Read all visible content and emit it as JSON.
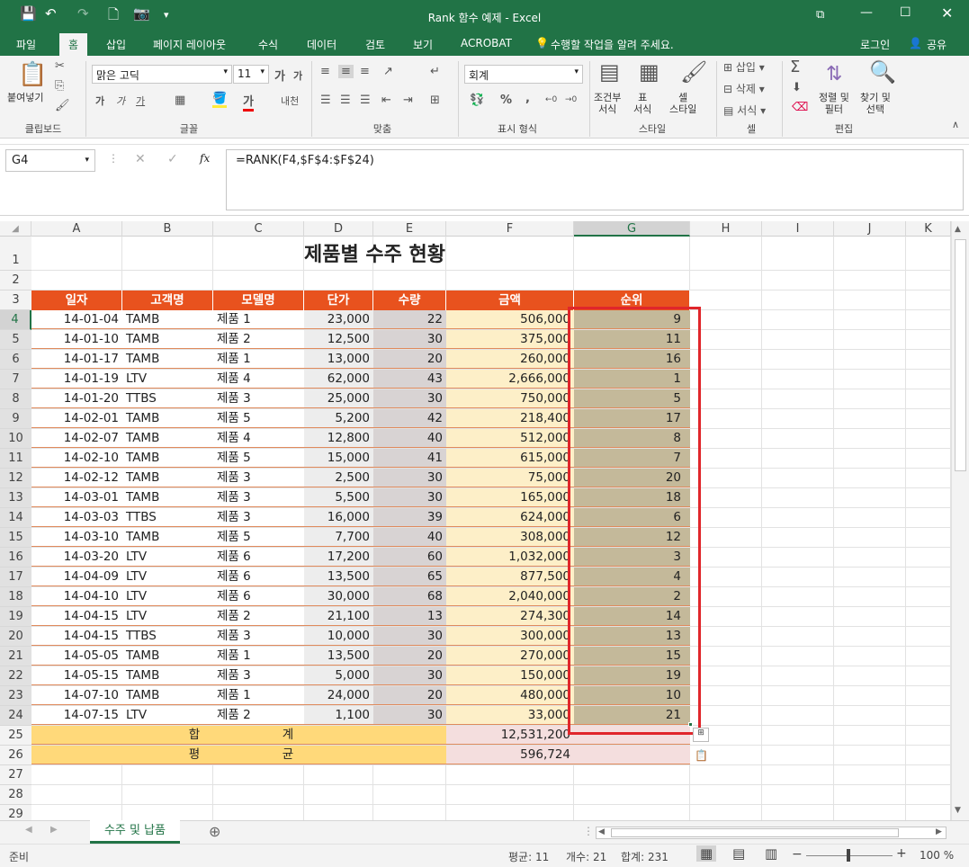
{
  "window": {
    "title": "Rank 함수 예제 - Excel",
    "qa_save": "💾",
    "qa_undo": "↶",
    "qa_redo": "↷",
    "qa_new": "🗋",
    "qa_camera": "📷",
    "qa_more": "▾"
  },
  "menu": {
    "tabs": [
      "파일",
      "홈",
      "삽입",
      "페이지 레이아웃",
      "수식",
      "데이터",
      "검토",
      "보기",
      "ACROBAT"
    ],
    "tell": "수행할 작업을 알려 주세요.",
    "login": "로그인",
    "share": "공유"
  },
  "ribbon": {
    "clipboard": {
      "paste": "붙여넣기",
      "group": "클립보드"
    },
    "font": {
      "name": "맑은 고딕",
      "size": "11",
      "bold": "가",
      "italic": "가",
      "underline": "가",
      "group": "글꼴",
      "grow": "가",
      "shrink": "가",
      "phonetic": "내천"
    },
    "align": {
      "group": "맞춤"
    },
    "number": {
      "format": "회계",
      "group": "표시 형식",
      "pct": "%",
      "comma": ","
    },
    "styles": {
      "cond": "조건부",
      "cond2": "서식",
      "table": "표",
      "table2": "서식",
      "cell": "셀",
      "cell2": "스타일",
      "group": "스타일"
    },
    "cells": {
      "insert": "삽입",
      "delete": "삭제",
      "format": "서식",
      "group": "셀"
    },
    "editing": {
      "sort": "정렬 및",
      "sort2": "필터",
      "find": "찾기 및",
      "find2": "선택",
      "group": "편집",
      "sigma": "Σ"
    }
  },
  "formula_bar": {
    "name_box": "G4",
    "fx": "fx",
    "formula": "=RANK(F4,$F$4:$F$24)"
  },
  "columns": [
    "A",
    "B",
    "C",
    "D",
    "E",
    "F",
    "G",
    "H",
    "I",
    "J",
    "K"
  ],
  "rows": [
    "1",
    "2",
    "3",
    "4",
    "5",
    "6",
    "7",
    "8",
    "9",
    "10",
    "11",
    "12",
    "13",
    "14",
    "15",
    "16",
    "17",
    "18",
    "19",
    "20",
    "21",
    "22",
    "23",
    "24",
    "25",
    "26",
    "27",
    "28",
    "29"
  ],
  "sheet": {
    "title": "제품별 수주 현황",
    "headers": [
      "일자",
      "고객명",
      "모델명",
      "단가",
      "수량",
      "금액",
      "순위"
    ],
    "data": [
      [
        "14-01-04",
        "TAMB",
        "제품 1",
        "23,000",
        "22",
        "506,000",
        "9"
      ],
      [
        "14-01-10",
        "TAMB",
        "제품 2",
        "12,500",
        "30",
        "375,000",
        "11"
      ],
      [
        "14-01-17",
        "TAMB",
        "제품 1",
        "13,000",
        "20",
        "260,000",
        "16"
      ],
      [
        "14-01-19",
        "LTV",
        "제품 4",
        "62,000",
        "43",
        "2,666,000",
        "1"
      ],
      [
        "14-01-20",
        "TTBS",
        "제품 3",
        "25,000",
        "30",
        "750,000",
        "5"
      ],
      [
        "14-02-01",
        "TAMB",
        "제품 5",
        "5,200",
        "42",
        "218,400",
        "17"
      ],
      [
        "14-02-07",
        "TAMB",
        "제품 4",
        "12,800",
        "40",
        "512,000",
        "8"
      ],
      [
        "14-02-10",
        "TAMB",
        "제품 5",
        "15,000",
        "41",
        "615,000",
        "7"
      ],
      [
        "14-02-12",
        "TAMB",
        "제품 3",
        "2,500",
        "30",
        "75,000",
        "20"
      ],
      [
        "14-03-01",
        "TAMB",
        "제품 3",
        "5,500",
        "30",
        "165,000",
        "18"
      ],
      [
        "14-03-03",
        "TTBS",
        "제품 3",
        "16,000",
        "39",
        "624,000",
        "6"
      ],
      [
        "14-03-10",
        "TAMB",
        "제품 5",
        "7,700",
        "40",
        "308,000",
        "12"
      ],
      [
        "14-03-20",
        "LTV",
        "제품 6",
        "17,200",
        "60",
        "1,032,000",
        "3"
      ],
      [
        "14-04-09",
        "LTV",
        "제품 6",
        "13,500",
        "65",
        "877,500",
        "4"
      ],
      [
        "14-04-10",
        "LTV",
        "제품 6",
        "30,000",
        "68",
        "2,040,000",
        "2"
      ],
      [
        "14-04-15",
        "LTV",
        "제품 2",
        "21,100",
        "13",
        "274,300",
        "14"
      ],
      [
        "14-04-15",
        "TTBS",
        "제품 3",
        "10,000",
        "30",
        "300,000",
        "13"
      ],
      [
        "14-05-05",
        "TAMB",
        "제품 1",
        "13,500",
        "20",
        "270,000",
        "15"
      ],
      [
        "14-05-15",
        "TAMB",
        "제품 3",
        "5,000",
        "30",
        "150,000",
        "19"
      ],
      [
        "14-07-10",
        "TAMB",
        "제품 1",
        "24,000",
        "20",
        "480,000",
        "10"
      ],
      [
        "14-07-15",
        "LTV",
        "제품 2",
        "1,100",
        "30",
        "33,000",
        "21"
      ]
    ],
    "sum_label_1": "합",
    "sum_label_2": "계",
    "sum_value": "12,531,200",
    "avg_label_1": "평",
    "avg_label_2": "균",
    "avg_value": "596,724"
  },
  "sheet_tab": "수주 및 납품",
  "status": {
    "ready": "준비",
    "avg": "평균: 11",
    "count": "개수: 21",
    "sum": "합계: 231",
    "zoom": "100 %"
  }
}
